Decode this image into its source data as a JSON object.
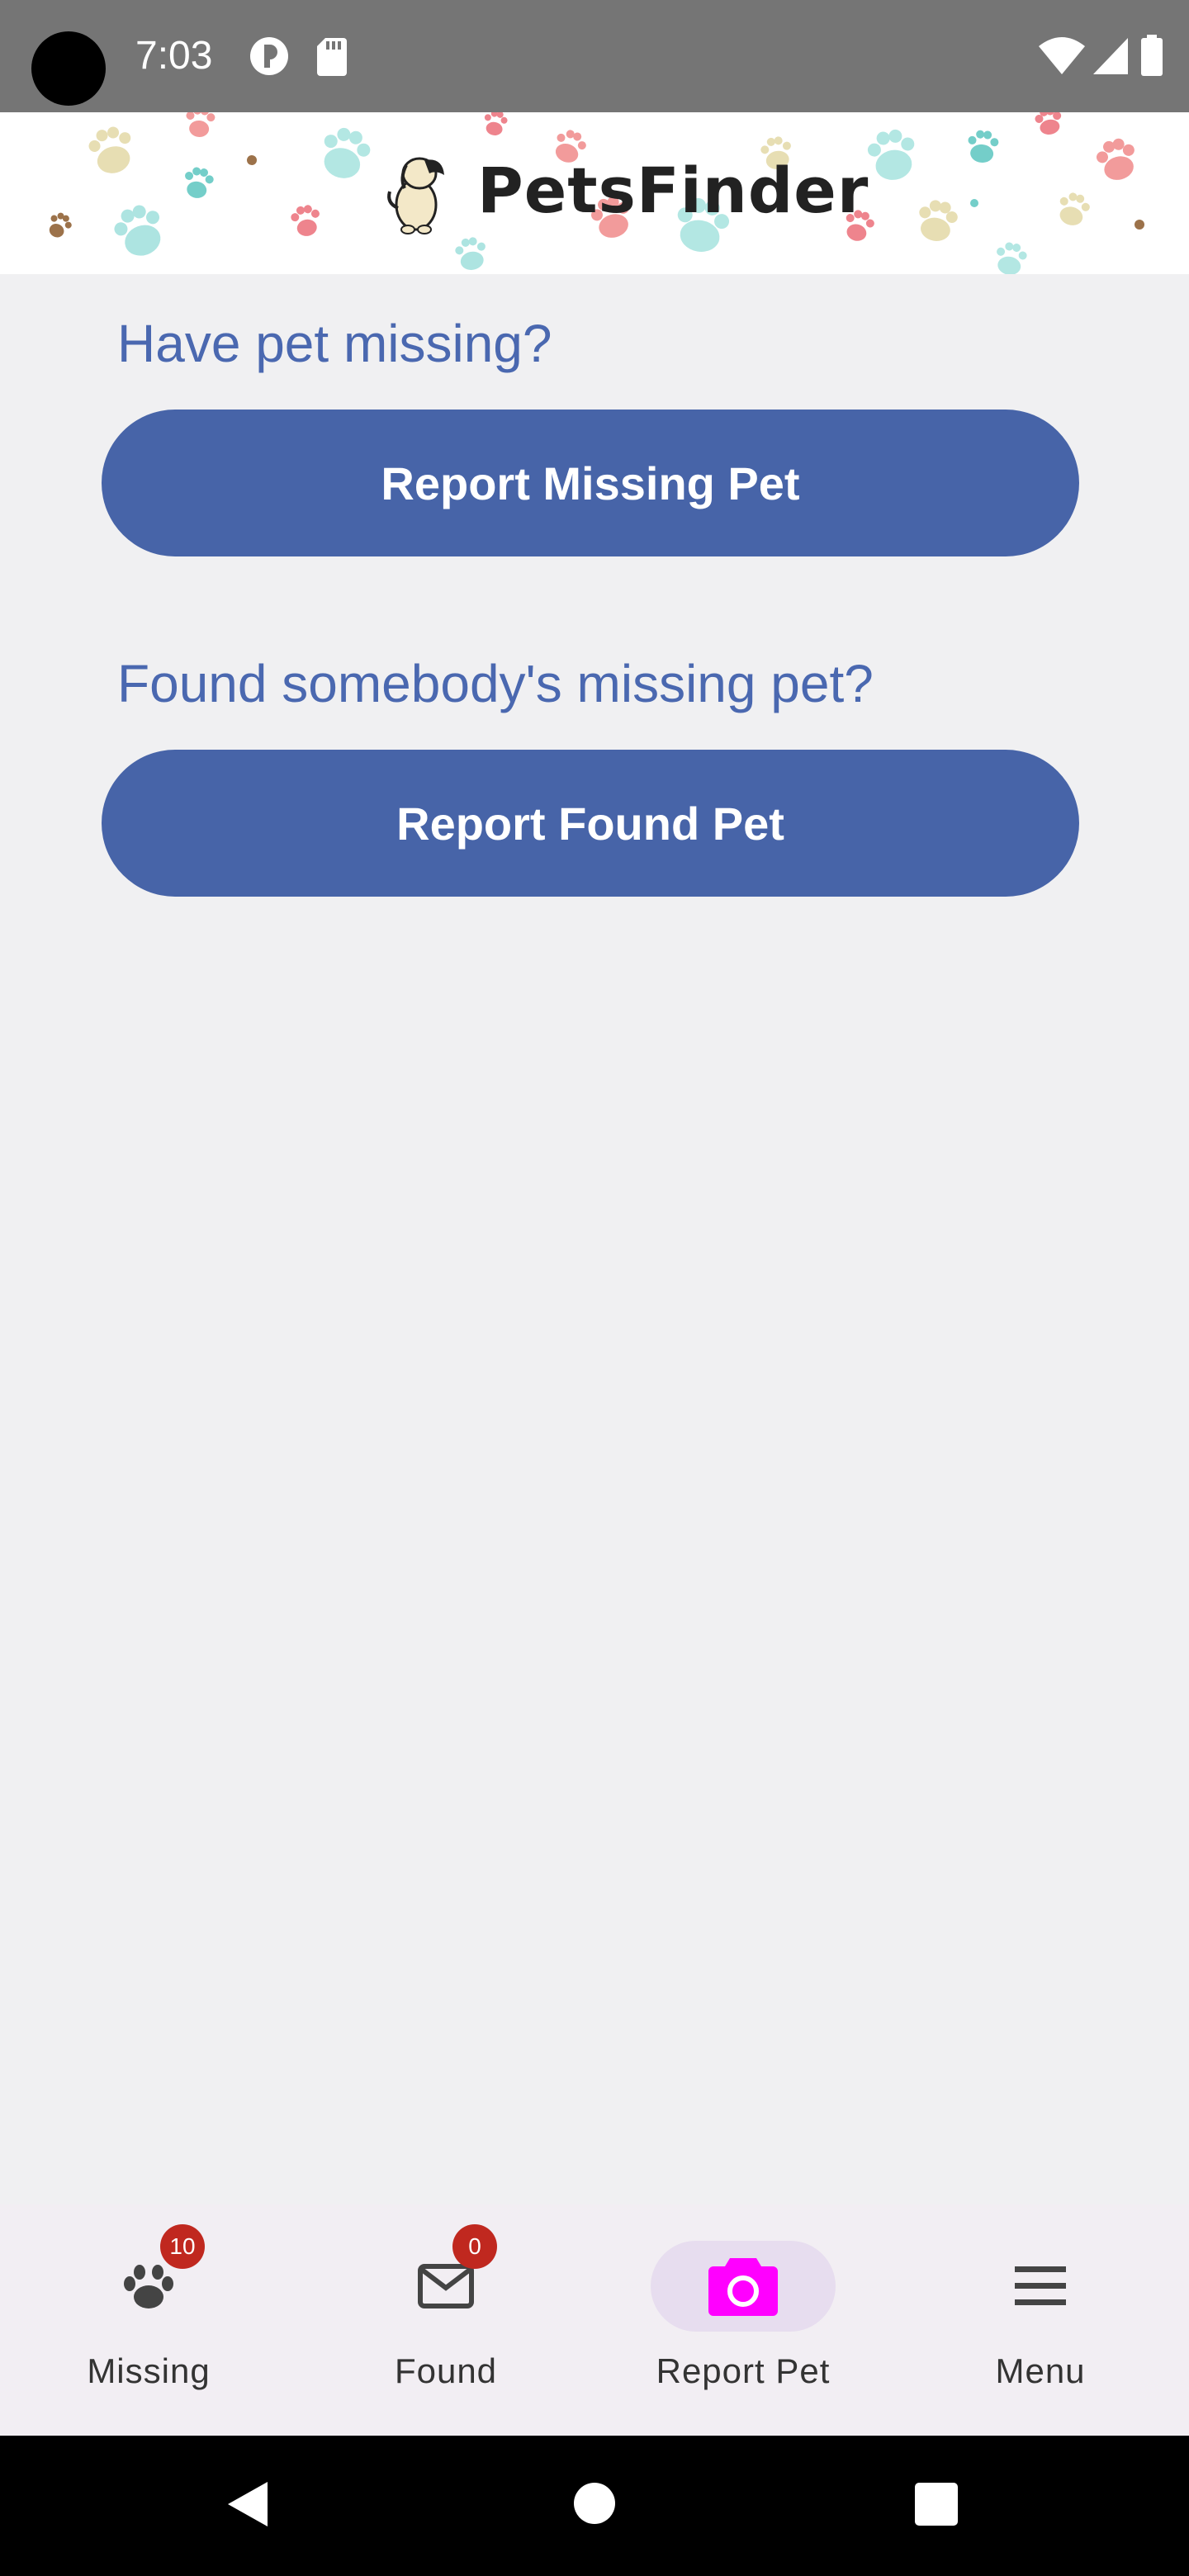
{
  "status_bar": {
    "time": "7:03"
  },
  "header": {
    "app_title": "PetsFinder",
    "logo_icon": "dog-logo-icon"
  },
  "main": {
    "missing_prompt": "Have pet missing?",
    "report_missing_label": "Report Missing Pet",
    "found_prompt": "Found somebody's missing pet?",
    "report_found_label": "Report Found Pet"
  },
  "bottom_nav": {
    "items": [
      {
        "label": "Missing",
        "icon": "paw-icon",
        "badge": "10",
        "active": false
      },
      {
        "label": "Found",
        "icon": "mail-icon",
        "badge": "0",
        "active": false
      },
      {
        "label": "Report Pet",
        "icon": "camera-icon",
        "active": true
      },
      {
        "label": "Menu",
        "icon": "menu-icon",
        "active": false
      }
    ]
  },
  "colors": {
    "primary": "#4764a8",
    "prompt_text": "#4a68b0",
    "active_icon": "#ff00ff",
    "active_pill": "#e7ddef",
    "badge": "#c0281f",
    "background": "#f0f0f2"
  }
}
